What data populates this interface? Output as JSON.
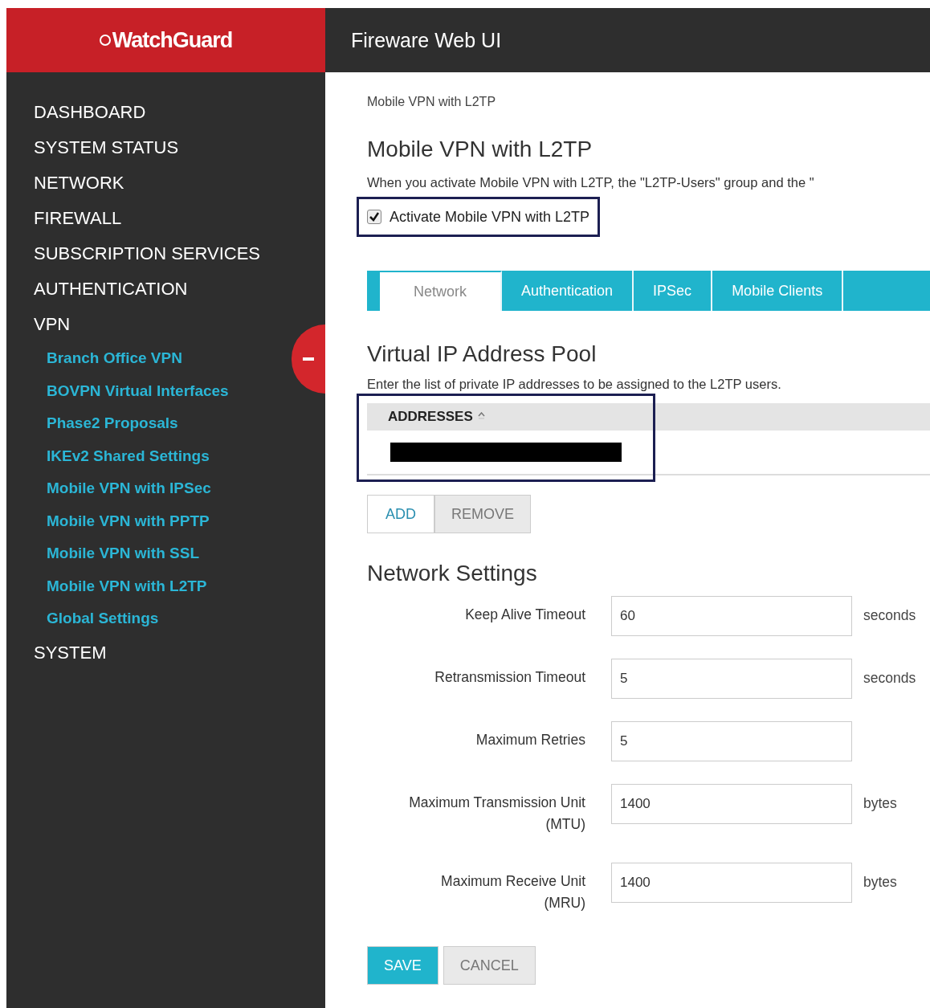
{
  "header": {
    "logo": "WatchGuard",
    "title": "Fireware Web UI"
  },
  "sidebar": {
    "items": [
      {
        "label": "DASHBOARD"
      },
      {
        "label": "SYSTEM STATUS"
      },
      {
        "label": "NETWORK"
      },
      {
        "label": "FIREWALL"
      },
      {
        "label": "SUBSCRIPTION SERVICES"
      },
      {
        "label": "AUTHENTICATION"
      },
      {
        "label": "VPN",
        "children": [
          {
            "label": "Branch Office VPN"
          },
          {
            "label": "BOVPN Virtual Interfaces"
          },
          {
            "label": "Phase2 Proposals"
          },
          {
            "label": "IKEv2 Shared Settings"
          },
          {
            "label": "Mobile VPN with IPSec"
          },
          {
            "label": "Mobile VPN with PPTP"
          },
          {
            "label": "Mobile VPN with SSL"
          },
          {
            "label": "Mobile VPN with L2TP"
          },
          {
            "label": "Global Settings"
          }
        ]
      },
      {
        "label": "SYSTEM"
      }
    ]
  },
  "breadcrumb": "Mobile VPN with L2TP",
  "title": "Mobile VPN with L2TP",
  "description": "When you activate Mobile VPN with L2TP, the \"L2TP-Users\" group and the \"",
  "activate": {
    "label": "Activate Mobile VPN with L2TP",
    "checked": true
  },
  "tabs": [
    {
      "label": "Network",
      "selected": true
    },
    {
      "label": "Authentication",
      "selected": false
    },
    {
      "label": "IPSec",
      "selected": false
    },
    {
      "label": "Mobile Clients",
      "selected": false
    }
  ],
  "pool": {
    "title": "Virtual IP Address Pool",
    "description": "Enter the list of private IP addresses to be assigned to the L2TP users.",
    "table": {
      "columns": [
        "ADDRESSES"
      ]
    },
    "buttons": [
      {
        "label": "ADD",
        "kind": "active"
      },
      {
        "label": "REMOVE",
        "kind": "plain"
      }
    ]
  },
  "network_settings": {
    "title": "Network Settings",
    "fields": [
      {
        "label": "Keep Alive Timeout",
        "value": "60",
        "unit": "seconds"
      },
      {
        "label": "Retransmission Timeout",
        "value": "5",
        "unit": "seconds"
      },
      {
        "label": "Maximum Retries",
        "value": "5"
      },
      {
        "label": "Maximum Transmission Unit (MTU)",
        "value": "1400",
        "unit": "bytes"
      },
      {
        "label": "Maximum Receive Unit (MRU)",
        "value": "1400",
        "unit": "bytes"
      }
    ]
  },
  "footer_buttons": [
    {
      "label": "SAVE",
      "kind": "primary"
    },
    {
      "label": "CANCEL",
      "kind": "secondary"
    }
  ]
}
